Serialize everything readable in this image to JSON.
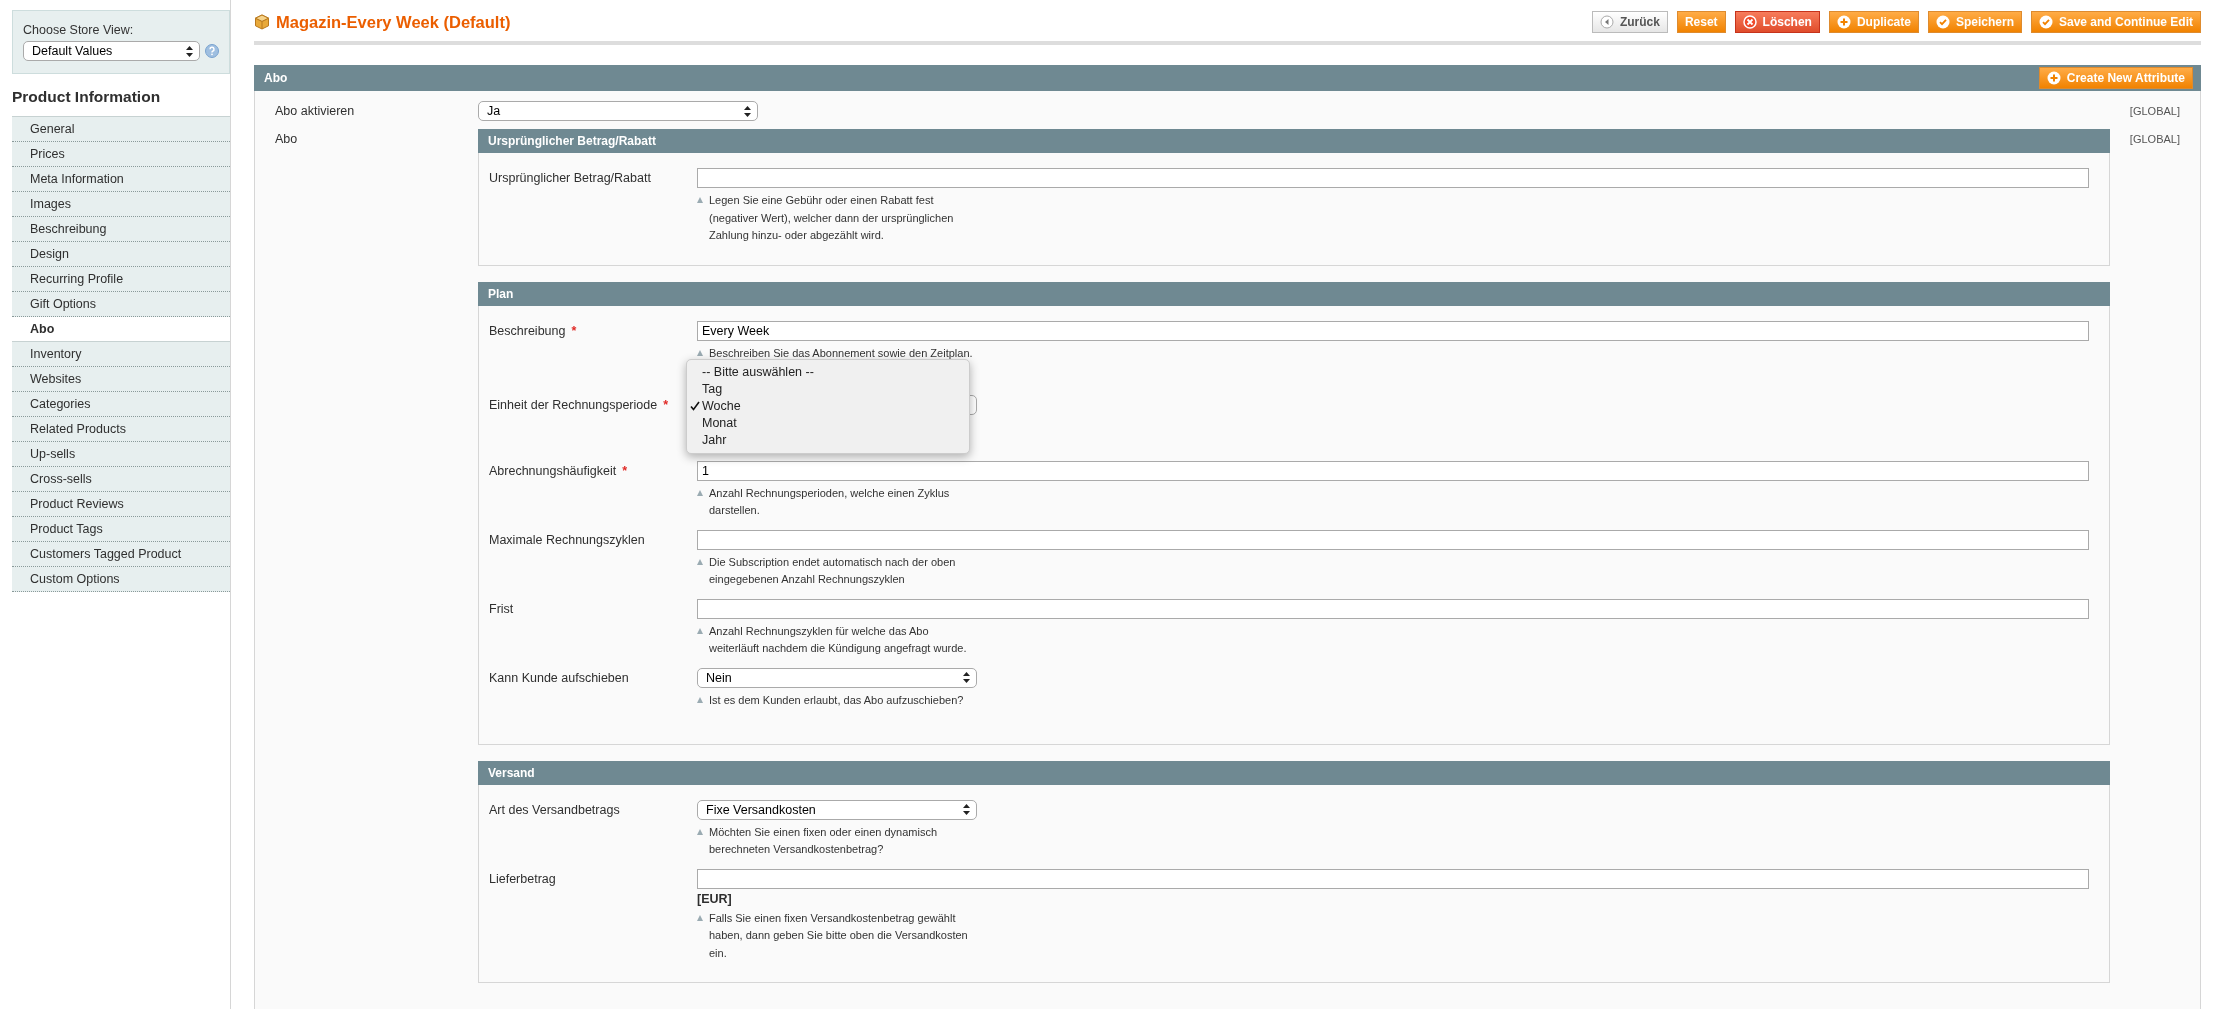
{
  "sidebar": {
    "store_view_label": "Choose Store View:",
    "store_view": "Default Values",
    "title": "Product Information",
    "items": [
      {
        "label": "General",
        "selected": false
      },
      {
        "label": "Prices",
        "selected": false
      },
      {
        "label": "Meta Information",
        "selected": false
      },
      {
        "label": "Images",
        "selected": false
      },
      {
        "label": "Beschreibung",
        "selected": false
      },
      {
        "label": "Design",
        "selected": false
      },
      {
        "label": "Recurring Profile",
        "selected": false
      },
      {
        "label": "Gift Options",
        "selected": false
      },
      {
        "label": "Abo",
        "selected": true
      },
      {
        "label": "Inventory",
        "selected": false
      },
      {
        "label": "Websites",
        "selected": false
      },
      {
        "label": "Categories",
        "selected": false
      },
      {
        "label": "Related Products",
        "selected": false
      },
      {
        "label": "Up-sells",
        "selected": false
      },
      {
        "label": "Cross-sells",
        "selected": false
      },
      {
        "label": "Product Reviews",
        "selected": false
      },
      {
        "label": "Product Tags",
        "selected": false
      },
      {
        "label": "Customers Tagged Product",
        "selected": false
      },
      {
        "label": "Custom Options",
        "selected": false
      }
    ]
  },
  "page": {
    "title": "Magazin-Every Week (Default)",
    "buttons": [
      {
        "label": "Zurück",
        "kind": "back"
      },
      {
        "label": "Reset",
        "kind": "plain"
      },
      {
        "label": "Löschen",
        "kind": "delete"
      },
      {
        "label": "Duplicate",
        "kind": "add"
      },
      {
        "label": "Speichern",
        "kind": "save"
      },
      {
        "label": "Save and Continue Edit",
        "kind": "save"
      }
    ]
  },
  "section": {
    "title": "Abo",
    "action": "Create New Attribute",
    "rows": [
      {
        "label": "Abo aktivieren",
        "kind": "select",
        "value": "Ja",
        "scope": "[GLOBAL]"
      },
      {
        "label": "Abo",
        "kind": "group",
        "scope": "[GLOBAL]",
        "groups": [
          {
            "title": "Ursprünglicher Betrag/Rabatt",
            "fields": [
              {
                "label": "Ursprünglicher Betrag/Rabatt",
                "kind": "text",
                "hint": [
                  "Legen Sie eine Gebühr oder einen Rabatt fest",
                  "(negativer Wert), welcher dann der ursprünglichen",
                  "Zahlung hinzu- oder abgezählt wird."
                ]
              }
            ]
          },
          {
            "title": "Plan",
            "fields": [
              {
                "label": "Beschreibung",
                "required_mark": "*",
                "kind": "text",
                "value": "Every Week",
                "hint": [
                  "Beschreiben Sie das Abonnement sowie den Zeitplan."
                ]
              },
              {
                "label": "Einheit der Rechnungsperiode",
                "required_mark": "*",
                "kind": "select",
                "open": true,
                "options": [
                  {
                    "label": "-- Bitte auswählen --",
                    "selected": false
                  },
                  {
                    "label": "Tag",
                    "selected": false
                  },
                  {
                    "label": "Woche",
                    "selected": true
                  },
                  {
                    "label": "Monat",
                    "selected": false
                  },
                  {
                    "label": "Jahr",
                    "selected": false
                  }
                ]
              },
              {
                "label": "Abrechnungshäufigkeit",
                "required_mark": "*",
                "kind": "text",
                "value": "1",
                "hint": [
                  "Anzahl Rechnungsperioden, welche einen Zyklus",
                  "darstellen."
                ]
              },
              {
                "label": "Maximale Rechnungszyklen",
                "kind": "text",
                "hint": [
                  "Die Subscription endet automatisch nach der oben",
                  "eingegebenen Anzahl Rechnungszyklen"
                ]
              },
              {
                "label": "Frist",
                "kind": "text",
                "hint": [
                  "Anzahl Rechnungszyklen für welche das Abo",
                  "weiterläuft nachdem die Kündigung angefragt wurde."
                ]
              },
              {
                "label": "Kann Kunde aufschieben",
                "kind": "select",
                "value": "Nein",
                "hint": [
                  "Ist es dem Kunden erlaubt, das Abo aufzuschieben?"
                ]
              }
            ]
          },
          {
            "title": "Versand",
            "fields": [
              {
                "label": "Art des Versandbetrags",
                "kind": "select",
                "value": "Fixe Versandkosten",
                "hint": [
                  "Möchten Sie einen fixen oder einen dynamisch",
                  "berechneten Versandkostenbetrag?"
                ]
              },
              {
                "label": "Lieferbetrag",
                "kind": "text",
                "unit": "[EUR]",
                "hint": [
                  "Falls Sie einen fixen Versandkostenbetrag gewählt",
                  "haben, dann geben Sie bitte oben die Versandkosten",
                  "ein."
                ]
              }
            ]
          }
        ]
      }
    ]
  }
}
